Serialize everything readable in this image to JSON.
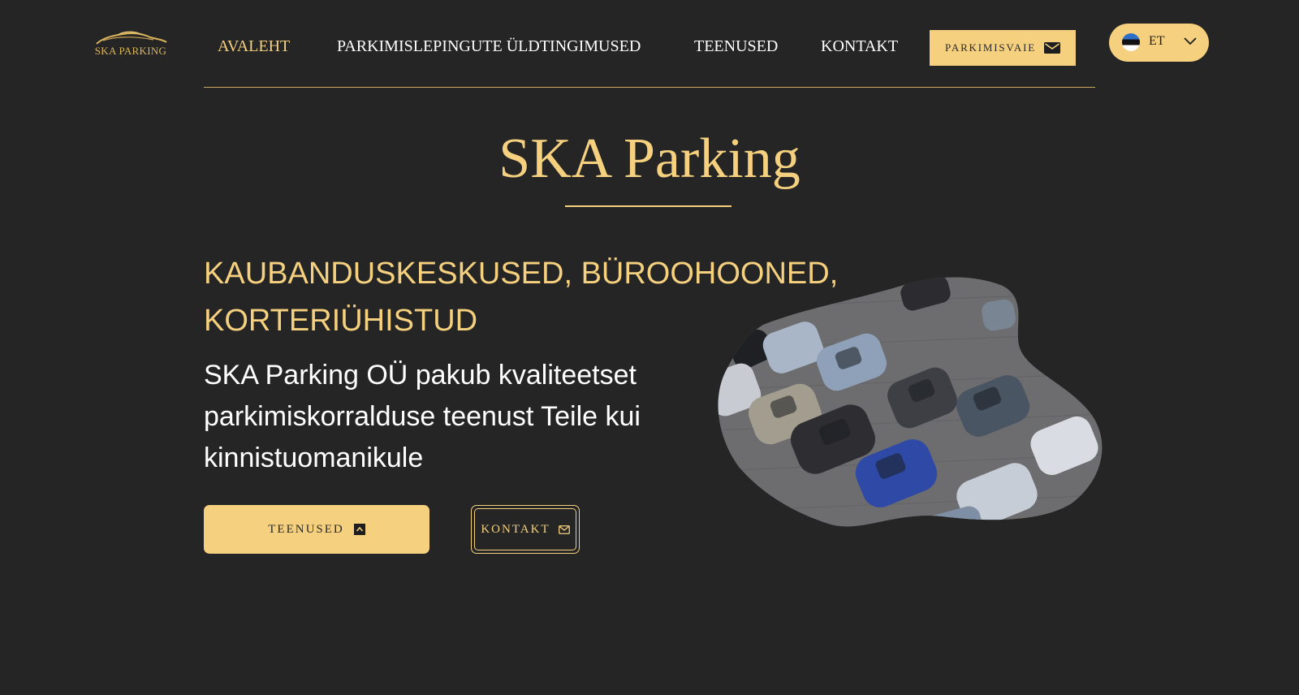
{
  "logo": {
    "text": "SKA PARKING"
  },
  "nav": {
    "items": [
      {
        "label": "AVALEHT",
        "active": true
      },
      {
        "label": "PARKIMISLEPINGUTE ÜLDTINGIMUSED",
        "active": false
      },
      {
        "label": "TEENUSED",
        "active": false
      },
      {
        "label": "KONTAKT",
        "active": false
      }
    ],
    "parkimisvaie_label": "PARKIMISVAIE",
    "language": {
      "code": "ET",
      "flag": "estonia-flag"
    }
  },
  "hero": {
    "title": "SKA Parking",
    "subheading_lines": [
      "KAUBANDUSKESKUSED, BÜROOHOONED,",
      "KORTERIÜHISTUD"
    ],
    "description_lines": [
      "SKA Parking OÜ pakub kvaliteetset",
      "parkimiskorralduse teenust Teile kui",
      "kinnistuomanikule"
    ],
    "primary_button_label": "TEENUSED",
    "secondary_button_label": "KONTAKT"
  },
  "colors": {
    "background": "#252525",
    "accent": "#f5d07e",
    "text": "#ffffff"
  },
  "icons": {
    "parkimisvaie": "envelope-icon",
    "primary_button": "arrow-up-icon",
    "secondary_button": "envelope-icon",
    "language": "chevron-down-icon"
  }
}
